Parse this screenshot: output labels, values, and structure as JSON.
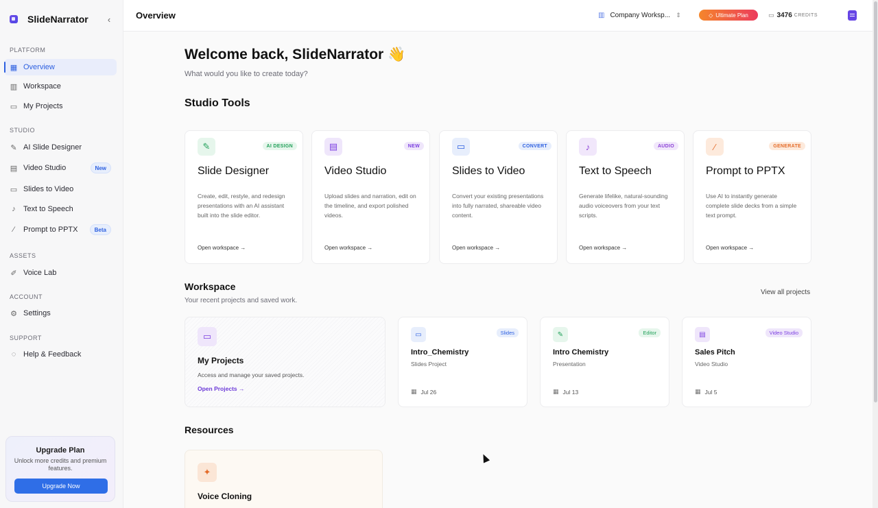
{
  "sidebar": {
    "brand": "SlideNarrator",
    "sections": {
      "platform": "PLATFORM",
      "studio": "STUDIO",
      "assets": "ASSETS",
      "account": "ACCOUNT",
      "support": "SUPPORT"
    },
    "items": [
      {
        "label": "Overview",
        "icon": "grid-icon",
        "active": true
      },
      {
        "label": "Workspace",
        "icon": "building-icon"
      },
      {
        "label": "My Projects",
        "icon": "folder-icon"
      },
      {
        "label": "AI Slide Designer",
        "icon": "edit-icon"
      },
      {
        "label": "Video Studio",
        "icon": "film-icon",
        "pill": "New"
      },
      {
        "label": "Slides to Video",
        "icon": "monitor-icon"
      },
      {
        "label": "Text to Speech",
        "icon": "mic-icon"
      },
      {
        "label": "Prompt to PPTX",
        "icon": "wand-icon",
        "pill": "Beta"
      },
      {
        "label": "Voice Lab",
        "icon": "pen-icon"
      },
      {
        "label": "Settings",
        "icon": "gear-icon"
      },
      {
        "label": "Help & Feedback",
        "icon": "chat-icon"
      }
    ],
    "upgrade": {
      "title": "Upgrade Plan",
      "desc": "Unlock more credits and premium features.",
      "button": "Upgrade Now"
    }
  },
  "header": {
    "title": "Overview",
    "workspace": "Company Worksp...",
    "plan": "Ultimate Plan",
    "credits": "3476",
    "credits_label": "CREDITS"
  },
  "main": {
    "welcome": "Welcome back, SlideNarrator 👋",
    "welcome_sub": "What would you like to create today?",
    "studio_title": "Studio Tools",
    "tools": [
      {
        "title": "Slide Designer",
        "tag": "AI DESIGN",
        "desc": "Create, edit, restyle, and redesign presentations with an AI assistant built into the slide editor.",
        "link": "Open workspace →",
        "icon": "edit-icon",
        "color": "#22a05a",
        "bg": "#e6f6ec"
      },
      {
        "title": "Video Studio",
        "tag": "NEW",
        "desc": "Upload slides and narration, edit on the timeline, and export polished videos.",
        "link": "Open workspace →",
        "icon": "film-icon",
        "color": "#7b3fe0",
        "bg": "#efe6fb"
      },
      {
        "title": "Slides to Video",
        "tag": "CONVERT",
        "desc": "Convert your existing presentations into fully narrated, shareable video content.",
        "link": "Open workspace →",
        "icon": "monitor-icon",
        "color": "#2c5fe0",
        "bg": "#e7eefc"
      },
      {
        "title": "Text to Speech",
        "tag": "AUDIO",
        "desc": "Generate lifelike, natural-sounding audio voiceovers from your text scripts.",
        "link": "Open workspace →",
        "icon": "mic-icon",
        "color": "#8a3fd6",
        "bg": "#f1e7fb"
      },
      {
        "title": "Prompt to PPTX",
        "tag": "GENERATE",
        "desc": "Use AI to instantly generate complete slide decks from a simple text prompt.",
        "link": "Open workspace →",
        "icon": "wand-icon",
        "color": "#e46c2a",
        "bg": "#fdeadc"
      }
    ],
    "workspace_title": "Workspace",
    "workspace_sub": "Your recent projects and saved work.",
    "view_all": "View all projects",
    "my_projects": {
      "title": "My Projects",
      "desc": "Access and manage your saved projects.",
      "link": "Open Projects →"
    },
    "recent": [
      {
        "title": "Intro_Chemistry",
        "type": "Slides Project",
        "tag": "Slides",
        "date": "Jul 26",
        "icon": "monitor-icon",
        "color": "#2c5fe0",
        "bg": "#e7eefc"
      },
      {
        "title": "Intro Chemistry",
        "type": "Presentation",
        "tag": "Editor",
        "date": "Jul 13",
        "icon": "edit-icon",
        "color": "#22a05a",
        "bg": "#e6f6ec"
      },
      {
        "title": "Sales Pitch",
        "type": "Video Studio",
        "tag": "Video Studio",
        "date": "Jul 5",
        "icon": "film-icon",
        "color": "#7b3fe0",
        "bg": "#efe6fb"
      }
    ],
    "resources_title": "Resources",
    "resource": {
      "title": "Voice Cloning",
      "icon": "sparkle-icon"
    }
  }
}
